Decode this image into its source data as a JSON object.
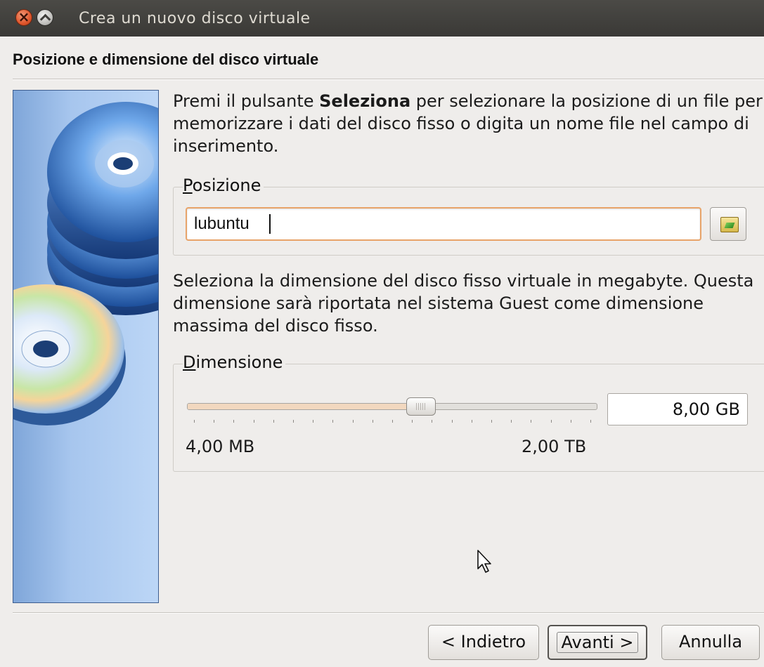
{
  "window": {
    "title": "Crea un nuovo disco virtuale"
  },
  "page": {
    "heading": "Posizione e dimensione del disco virtuale"
  },
  "location": {
    "intro_pre": "Premi il pulsante ",
    "intro_bold": "Seleziona",
    "intro_post": " per selezionare la posizione di un file per memorizzare i dati del disco fisso o digita un nome file nel campo di inserimento.",
    "group_label": "Posizione",
    "value": "lubuntu"
  },
  "size": {
    "intro": "Seleziona la dimensione del disco fisso virtuale in megabyte. Questa dimensione sarà riportata nel sistema Guest come dimensione massima del disco fisso.",
    "group_label": "Dimensione",
    "value": "8,00 GB",
    "min_label": "4,00 MB",
    "max_label": "2,00 TB",
    "slider_position_fraction": 0.57
  },
  "buttons": {
    "back": "< Indietro",
    "next": "Avanti >",
    "cancel": "Annulla"
  }
}
